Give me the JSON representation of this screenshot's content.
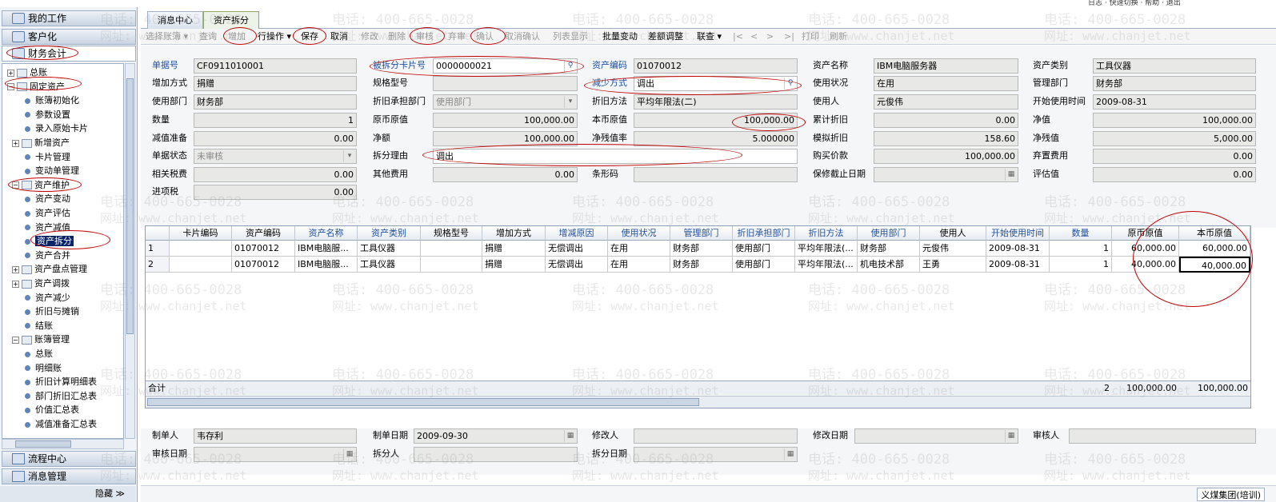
{
  "top_bar": {
    "icons_text": "日志  · 快速切换  · 帮助  · 退出"
  },
  "sidebar": {
    "my_work": "我的工作",
    "crm": "客户化",
    "finance": "财务会计",
    "tree": [
      {
        "label": "总账",
        "type": "folder",
        "toggle": "+"
      },
      {
        "label": "固定资产",
        "type": "folder",
        "toggle": "−"
      },
      {
        "label": "账簿初始化",
        "type": "leaf"
      },
      {
        "label": "参数设置",
        "type": "leaf"
      },
      {
        "label": "录入原始卡片",
        "type": "leaf"
      },
      {
        "label": "新增资产",
        "type": "folder",
        "toggle": "+"
      },
      {
        "label": "卡片管理",
        "type": "leaf"
      },
      {
        "label": "变动单管理",
        "type": "leaf"
      },
      {
        "label": "资产维护",
        "type": "folder",
        "toggle": "−"
      },
      {
        "label": "资产变动",
        "type": "leaf"
      },
      {
        "label": "资产评估",
        "type": "leaf"
      },
      {
        "label": "资产减值",
        "type": "leaf"
      },
      {
        "label": "资产拆分",
        "type": "leaf",
        "selected": true
      },
      {
        "label": "资产合并",
        "type": "leaf"
      },
      {
        "label": "资产盘点管理",
        "type": "folder",
        "toggle": "+"
      },
      {
        "label": "资产调拨",
        "type": "folder",
        "toggle": "+"
      },
      {
        "label": "资产减少",
        "type": "leaf"
      },
      {
        "label": "折旧与摊销",
        "type": "leaf"
      },
      {
        "label": "结账",
        "type": "leaf"
      },
      {
        "label": "账簿管理",
        "type": "folder",
        "toggle": "−"
      },
      {
        "label": "总账",
        "type": "leaf"
      },
      {
        "label": "明细账",
        "type": "leaf"
      },
      {
        "label": "折旧计算明细表",
        "type": "leaf"
      },
      {
        "label": "部门折旧汇总表",
        "type": "leaf"
      },
      {
        "label": "价值汇总表",
        "type": "leaf"
      },
      {
        "label": "减值准备汇总表",
        "type": "leaf"
      }
    ],
    "flow_center": "流程中心",
    "msg_mgmt": "消息管理",
    "hide": "隐藏 ≫"
  },
  "tabs": [
    "消息中心",
    "资产拆分"
  ],
  "toolbar": [
    {
      "label": "选择账簿 ▾",
      "disabled": true
    },
    {
      "label": "查询",
      "disabled": true
    },
    {
      "label": "增加",
      "disabled": true
    },
    {
      "label": "行操作 ▾",
      "disabled": false
    },
    {
      "label": "保存",
      "disabled": false
    },
    {
      "label": "取消",
      "disabled": false
    },
    {
      "label": "修改",
      "disabled": true
    },
    {
      "label": "删除",
      "disabled": true
    },
    {
      "label": "审核",
      "disabled": true
    },
    {
      "label": "弃审",
      "disabled": true
    },
    {
      "label": "确认",
      "disabled": true
    },
    {
      "label": "取消确认",
      "disabled": true
    },
    {
      "label": "列表显示",
      "disabled": true
    },
    {
      "label": "批量变动",
      "disabled": false
    },
    {
      "label": "差额调整",
      "disabled": false
    },
    {
      "label": "联查 ▾",
      "disabled": false
    },
    {
      "label": "|<",
      "disabled": true
    },
    {
      "label": "<",
      "disabled": true
    },
    {
      "label": ">",
      "disabled": true
    },
    {
      "label": ">|",
      "disabled": true
    },
    {
      "label": "打印",
      "disabled": true
    },
    {
      "label": "刷新",
      "disabled": true
    }
  ],
  "form": {
    "doc_no": {
      "label": "单据号",
      "value": "CF0911010001"
    },
    "split_card_no": {
      "label": "被拆分卡片号",
      "value": "0000000021"
    },
    "asset_code": {
      "label": "资产编码",
      "value": "01070012"
    },
    "asset_name": {
      "label": "资产名称",
      "value": "IBM电脑服务器"
    },
    "asset_type": {
      "label": "资产类别",
      "value": "工具仪器"
    },
    "add_method": {
      "label": "增加方式",
      "value": "捐赠"
    },
    "spec": {
      "label": "规格型号",
      "value": ""
    },
    "reduce_method": {
      "label": "减少方式",
      "value": "调出"
    },
    "use_status": {
      "label": "使用状况",
      "value": "在用"
    },
    "mgmt_dept": {
      "label": "管理部门",
      "value": "财务部"
    },
    "use_dept": {
      "label": "使用部门",
      "value": "财务部"
    },
    "dep_dept": {
      "label": "折旧承担部门",
      "value": "使用部门"
    },
    "dep_method": {
      "label": "折旧方法",
      "value": "平均年限法(二)"
    },
    "user": {
      "label": "使用人",
      "value": "元俊伟"
    },
    "start_date": {
      "label": "开始使用时间",
      "value": "2009-08-31"
    },
    "qty": {
      "label": "数量",
      "value": "1"
    },
    "orig_value": {
      "label": "原币原值",
      "value": "100,000.00"
    },
    "local_value": {
      "label": "本币原值",
      "value": "100,000.00"
    },
    "acc_dep": {
      "label": "累计折旧",
      "value": "0.00"
    },
    "net_value": {
      "label": "净值",
      "value": "100,000.00"
    },
    "impair": {
      "label": "减值准备",
      "value": "0.00"
    },
    "net_amount": {
      "label": "净额",
      "value": "100,000.00"
    },
    "salvage_rate": {
      "label": "净残值率",
      "value": "5.000000"
    },
    "sim_dep": {
      "label": "模拟折旧",
      "value": "158.60"
    },
    "salvage": {
      "label": "净残值",
      "value": "5,000.00"
    },
    "doc_status": {
      "label": "单据状态",
      "value": "未审核"
    },
    "split_reason": {
      "label": "拆分理由",
      "value": "调出"
    },
    "purchase_price": {
      "label": "购买价款",
      "value": "100,000.00"
    },
    "disposal_fee": {
      "label": "弃置费用",
      "value": "0.00"
    },
    "rel_tax": {
      "label": "相关税费",
      "value": "0.00"
    },
    "other_fee": {
      "label": "其他费用",
      "value": "0.00"
    },
    "barcode": {
      "label": "条形码",
      "value": ""
    },
    "warranty": {
      "label": "保修截止日期",
      "value": ""
    },
    "appraisal": {
      "label": "评估值",
      "value": "0.00"
    },
    "input_tax": {
      "label": "进项税",
      "value": "0.00"
    }
  },
  "grid": {
    "headers": [
      "",
      "卡片编码",
      "资产编码",
      "资产名称",
      "资产类别",
      "规格型号",
      "增加方式",
      "增减原因",
      "使用状况",
      "管理部门",
      "折旧承担部门",
      "折旧方法",
      "使用部门",
      "使用人",
      "开始使用时间",
      "数量",
      "原币原值",
      "本币原值"
    ],
    "rows": [
      [
        "1",
        "",
        "01070012",
        "IBM电脑服...",
        "工具仪器",
        "",
        "捐赠",
        "无偿调出",
        "在用",
        "财务部",
        "使用部门",
        "平均年限法(...",
        "财务部",
        "元俊伟",
        "2009-08-31",
        "1",
        "60,000.00",
        "60,000.00"
      ],
      [
        "2",
        "",
        "01070012",
        "IBM电脑服...",
        "工具仪器",
        "",
        "捐赠",
        "无偿调出",
        "在用",
        "财务部",
        "使用部门",
        "平均年限法(...",
        "机电技术部",
        "王勇",
        "2009-08-31",
        "1",
        "40,000.00",
        "40,000.00"
      ]
    ],
    "total_label": "合计",
    "total_qty": "2",
    "total_orig": "100,000.00",
    "total_local": "100,000.00"
  },
  "bottom": {
    "maker": {
      "label": "制单人",
      "value": "韦存利"
    },
    "make_date": {
      "label": "制单日期",
      "value": "2009-09-30"
    },
    "modifier": {
      "label": "修改人",
      "value": ""
    },
    "modify_date": {
      "label": "修改日期",
      "value": ""
    },
    "auditor": {
      "label": "审核人",
      "value": ""
    },
    "audit_date": {
      "label": "审核日期",
      "value": ""
    },
    "splitter": {
      "label": "拆分人",
      "value": ""
    },
    "split_date": {
      "label": "拆分日期",
      "value": ""
    }
  },
  "status_bar": {
    "org": "义煤集团(培训)"
  },
  "watermark": {
    "phone": "电话: 400-665-0028",
    "site": "网址: www.chanjet.net"
  }
}
